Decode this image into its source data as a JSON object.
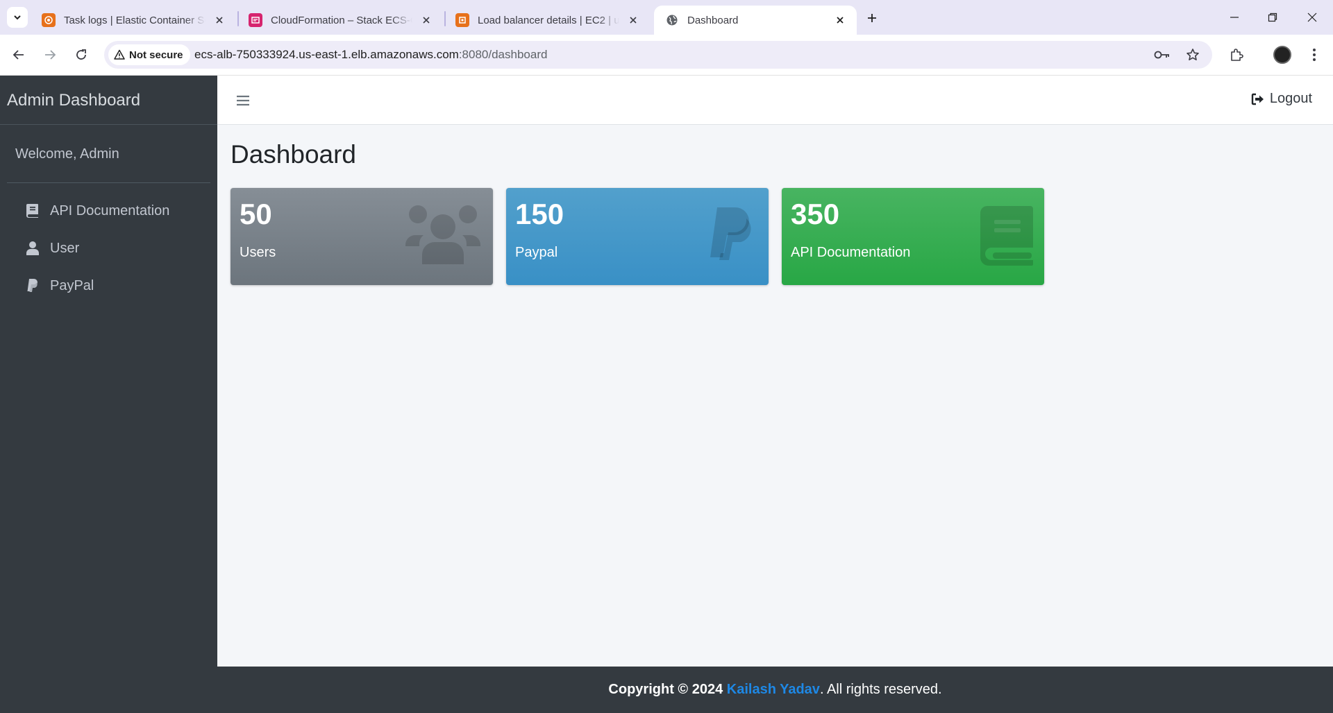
{
  "browser": {
    "tabs": [
      {
        "title": "Task logs | Elastic Container Ser",
        "favicon": "aws-ecs-icon",
        "active": false
      },
      {
        "title": "CloudFormation – Stack ECS-Co",
        "favicon": "aws-cloudformation-icon",
        "active": false
      },
      {
        "title": "Load balancer details | EC2 | us-",
        "favicon": "aws-ec2-icon",
        "active": false
      },
      {
        "title": "Dashboard",
        "favicon": "globe-icon",
        "active": true
      }
    ],
    "security_label": "Not secure",
    "url_host": "ecs-alb-750333924.us-east-1.elb.amazonaws.com",
    "url_path": ":8080/dashboard"
  },
  "app": {
    "brand": "Admin Dashboard",
    "welcome": "Welcome, Admin",
    "nav": [
      {
        "label": "API Documentation",
        "icon": "book-icon"
      },
      {
        "label": "User",
        "icon": "user-icon"
      },
      {
        "label": "PayPal",
        "icon": "paypal-icon"
      }
    ],
    "logout_label": "Logout",
    "page_title": "Dashboard",
    "boxes": [
      {
        "value": "50",
        "label": "Users",
        "icon": "users-icon",
        "color": "#6c757d"
      },
      {
        "value": "150",
        "label": "Paypal",
        "icon": "paypal-icon",
        "color": "#3c8dbc"
      },
      {
        "value": "350",
        "label": "API Documentation",
        "icon": "book-icon",
        "color": "#28a745"
      }
    ],
    "footer": {
      "prefix": "Copyright © 2024",
      "author": "Kailash Yadav",
      "suffix": ". All rights reserved.",
      "link_color": "#1e88e5"
    }
  }
}
